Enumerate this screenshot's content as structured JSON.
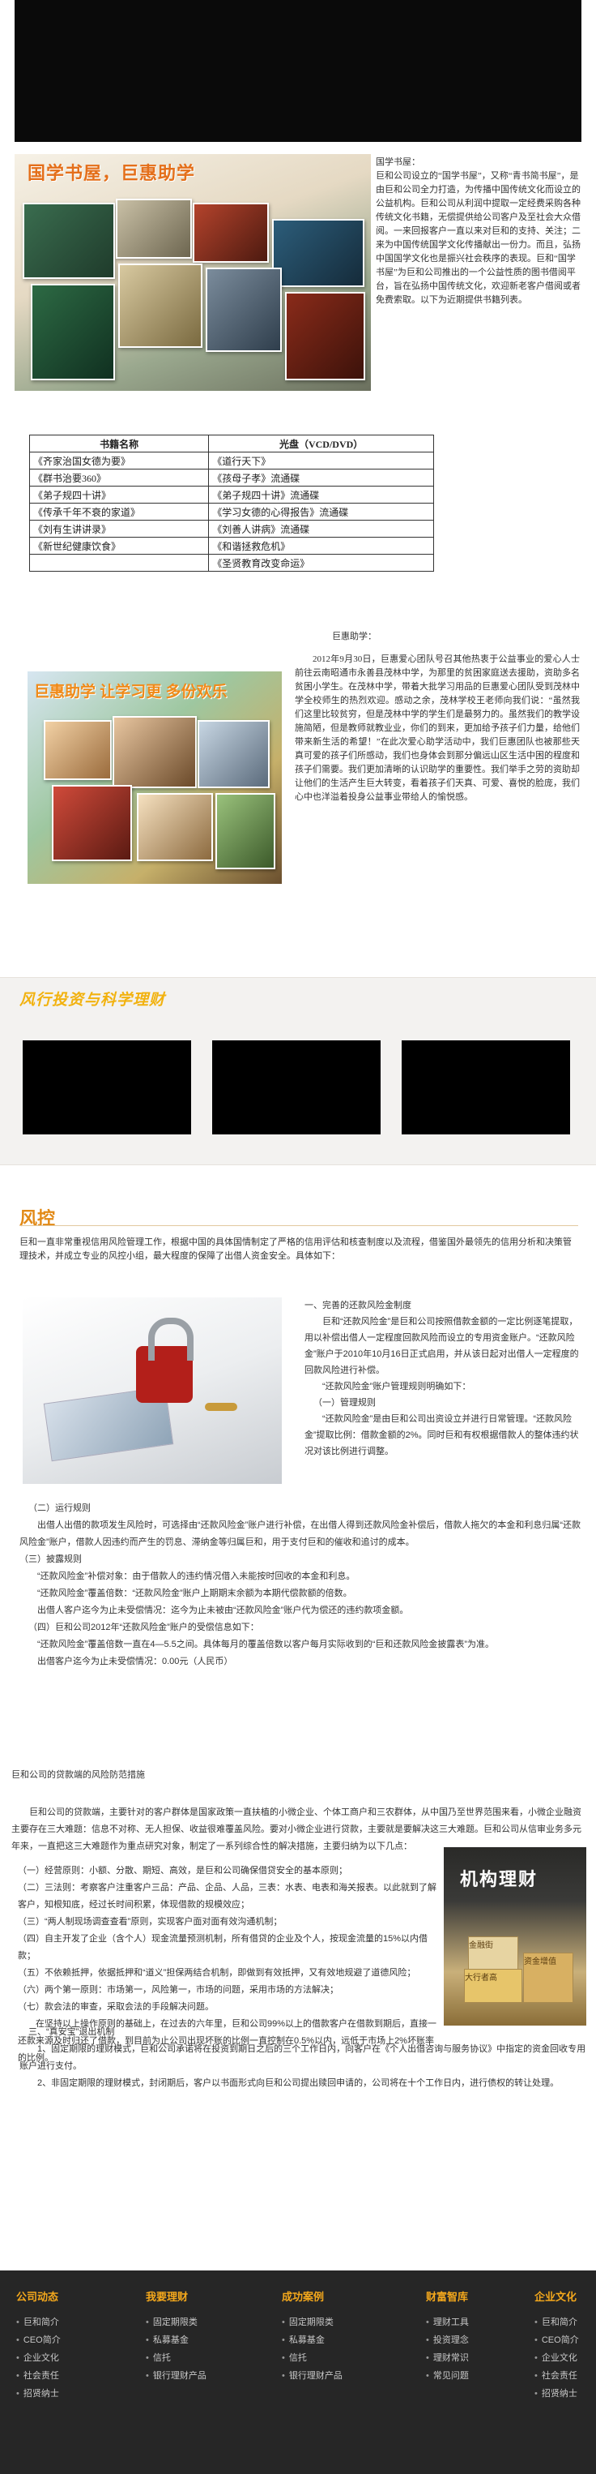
{
  "section1": {
    "title": "国学书屋，巨惠助学",
    "paragraph": "国学书屋：\n巨和公司设立的“国学书屋”，又称“青书简书屋”，是由巨和公司全力打造，为传播中国传统文化而设立的公益机构。巨和公司从利润中提取一定经费采购各种传统文化书籍，无偿提供给公司客户及至社会大众借阅。一来回报客户一直以来对巨和的支持、关注；二来为中国传统国学文化传播献出一份力。而且，弘扬中国国学文化也是振兴社会秩序的表现。巨和“国学书屋”为巨和公司推出的一个公益性质的图书借阅平台，旨在弘扬中国传统文化，欢迎新老客户借阅或者免费索取。以下为近期提供书籍列表。",
    "table": {
      "headers": [
        "书籍名称",
        "光盘（VCD/DVD）"
      ],
      "rows": [
        [
          "《齐家治国女德为要》",
          "《道行天下》"
        ],
        [
          "《群书治要360》",
          "《孩母子孝》流通碟"
        ],
        [
          "《弟子规四十讲》",
          "《弟子规四十讲》流通碟"
        ],
        [
          "《传承千年不衰的家道》",
          "《学习女德的心得报告》流通碟"
        ],
        [
          "《刘有生讲讲录》",
          "《刘善人讲病》流通碟"
        ],
        [
          "《新世纪健康饮食》",
          "《和谐拯救危机》"
        ],
        [
          "",
          "《圣贤教育改变命运》"
        ]
      ]
    }
  },
  "section2": {
    "greeting": "巨惠助学：",
    "image_caption": "巨惠助学 让学习更 多份欢乐",
    "paragraph": "2012年9月30日，巨惠爱心团队号召其他热衷于公益事业的爱心人士前往云南昭通市永善县茂林中学，为那里的贫困家庭送去援助，资助多名贫困小学生。在茂林中学，带着大批学习用品的巨惠爱心团队受到茂林中学全校师生的热烈欢迎。感动之余，茂林学校王老师向我们说：“虽然我们这里比较贫穷，但是茂林中学的学生们是最努力的。虽然我们的教学设施简陋，但是教师就教业业，你们的到来，更加给予孩子们力量，给他们带来新生活的希望！”在此次爱心助学活动中，我们巨惠团队也被那些天真可爱的孩子们所感动，我们也身体会到那分偏远山区生活中困的程度和孩子们需要。我们更加清晰的认识助学的重要性。我们举手之劳的资助却让他们的生活产生巨大转变，看着孩子们天真、可爱、喜悦的脸庞，我们心中也洋溢着投身公益事业带给人的愉悦感。"
  },
  "section3": {
    "title": "风行投资与科学理财"
  },
  "section4": {
    "heading": "风控",
    "intro": "巨和一直非常重视信用风险管理工作，根据中国的具体国情制定了严格的信用评估和核查制度以及流程，借鉴国外最领先的信用分析和决策管理技术，并成立专业的风控小组，最大程度的保障了出借人资金安全。具体如下：",
    "side_lines": [
      "一、完善的还款风险金制度",
      "巨和“还款风险金”是巨和公司按照借款金额的一定比例逐笔提取，用以补偿出借人一定程度回款风险而设立的专用资金账户。“还款风险金”账户于2010年10月16日正式启用，并从该日起对出借人一定程度的回款风险进行补偿。",
      "“还款风险金”账户管理规则明确如下：",
      "（一）管理规则",
      "“还款风险金”是由巨和公司出资设立并进行日常管理。“还款风险金”提取比例：借款金额的2%。同时巨和有权根据借款人的整体违约状况对该比例进行调整。"
    ],
    "body_lines": [
      "（二）运行规则",
      "出借人出借的款项发生风险时，可选择由“还款风险金”账户进行补偿，在出借人得到还款风险金补偿后，借款人拖欠的本金和利息归属“还款风险金”账户，借款人因违约而产生的罚息、滞纳金等归属巨和，用于支付巨和的催收和追讨的成本。",
      "（三）披露规则",
      "“还款风险金”补偿对象：由于借款人的违约情况借入未能按时回收的本金和利息。",
      "“还款风险金”覆盖倍数：“还款风险金”账户上期期末余额为本期代偿款额的倍数。",
      "出借人客户迄今为止未受偿情况：迄今为止未被由“还款风险金”账户代为偿还的违约款项金额。",
      "（四）巨和公司2012年“还款风险金”账户的受偿信息如下：",
      "“还款风险金”覆盖倍数一直在4—5.5之间。具体每月的覆盖倍数以客户每月实际收到的“巨和还款风险金披露表”为准。",
      "出借客户迄今为止未受偿情况：0.00元（人民币）"
    ],
    "sub_heading": "巨和公司的贷款端的风险防范措施",
    "sub_intro": "巨和公司的贷款端，主要针对的客户群体是国家政策一直扶植的小微企业、个体工商户和三农群体，从中国乃至世界范围来看，小微企业融资主要存在三大难题：信息不对称、无人担保、收益很难覆盖风险。要对小微企业进行贷款，主要就是要解决这三大难题。巨和公司从信审业务多元年来，一直把这三大难题作为重点研究对象，制定了一系列综合性的解决措施，主要归纳为以下几点：",
    "measures": [
      "（一）经营原则：小额、分散、期短、高效，是巨和公司确保借贷安全的基本原则；",
      "（二）三法则：考察客户注重客户三品：产品、企品、人品，三表：水表、电表和海关报表。以此就到了解客户，知根知底，经过长时间积累，体现借款的规模效应；",
      "（三）“两人制现场调查查看”原则，实现客户面对面有效沟通机制；",
      "（四）自主开发了企业（含个人）现金流量预测机制，所有借贷的企业及个人，按现金流量的15%以内借款；",
      "（五）不依赖抵押，依据抵押和“道义”担保两结合机制，即做到有效抵押，又有效地规避了道德风险；",
      "（六）两个第一原则：市场第一，风险第一，市场的问题，采用市场的方法解决；",
      "（七）款会法的审查，采取会法的手段解决问题。",
      "在坚持以上操作原则的基础上，在过去的六年里，巨和公司99%以上的借款客户在借款到期后，直接一还款来源及时归还了借款，到目前为止公司出现坏账的比例一直控制在0.5%以内，远低于市场上2%坏账率的比例。"
    ],
    "extra_heading": "三、“真安宝”退出机制",
    "extra_lines": [
      "1、固定期限的理财模式，巨和公司承诺将在投资到期日之后的三个工作日内，向客户在《个人出借咨询与服务协议》中指定的资金回收专用账户进行支付。",
      "2、非固定期限的理财模式，封闭期后，客户以书面形式向巨和公司提出赎回申请的，公司将在十个工作日内，进行债权的转让处理。"
    ],
    "side_image_caption": "机构理财",
    "side_image_labels": [
      "金融街",
      "大行者高",
      "资金增值"
    ]
  },
  "footer": {
    "columns": [
      {
        "title": "公司动态",
        "items": [
          "巨和简介",
          "CEO简介",
          "企业文化",
          "社会责任",
          "招贤纳士"
        ]
      },
      {
        "title": "我要理财",
        "items": [
          "固定期限类",
          "私募基金",
          "信托",
          "银行理财产品"
        ]
      },
      {
        "title": "成功案例",
        "items": [
          "固定期限类",
          "私募基金",
          "信托",
          "银行理财产品"
        ]
      },
      {
        "title": "财富智库",
        "items": [
          "理财工具",
          "投资理念",
          "理财常识",
          "常见问题"
        ]
      },
      {
        "title": "企业文化",
        "items": [
          "巨和简介",
          "CEO简介",
          "企业文化",
          "社会责任",
          "招贤纳士"
        ]
      }
    ]
  },
  "colors": {
    "accent_orange": "#e46f1a",
    "accent_yellow": "#f2b20f",
    "footer_bg": "#262626",
    "footer_heading": "#f4a81c"
  }
}
